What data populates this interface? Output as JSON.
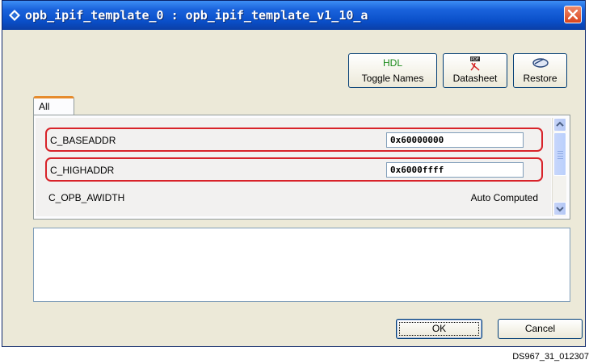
{
  "window": {
    "title": "opb_ipif_template_0 : opb_ipif_template_v1_10_a",
    "icon": "diamond-app-icon",
    "close": "close-icon"
  },
  "toolbar": {
    "toggle_names": {
      "top": "HDL",
      "label": "Toggle Names"
    },
    "datasheet": {
      "label": "Datasheet",
      "icon": "pdf-icon"
    },
    "restore": {
      "label": "Restore",
      "icon": "eraser-icon"
    }
  },
  "tabs": [
    {
      "label": "All",
      "selected": true
    }
  ],
  "params": [
    {
      "name": "C_BASEADDR",
      "value": "0x60000000",
      "kind": "input",
      "highlighted": true
    },
    {
      "name": "C_HIGHADDR",
      "value": "0x6000ffff",
      "kind": "input",
      "highlighted": true
    },
    {
      "name": "C_OPB_AWIDTH",
      "value": "Auto Computed",
      "kind": "static",
      "highlighted": false
    }
  ],
  "buttons": {
    "ok": "OK",
    "cancel": "Cancel"
  },
  "figure_id": "DS967_31_012307",
  "colors": {
    "highlight": "#d8232a",
    "titlebar": "#0a4fc9",
    "tab_accent": "#e68b2c"
  }
}
